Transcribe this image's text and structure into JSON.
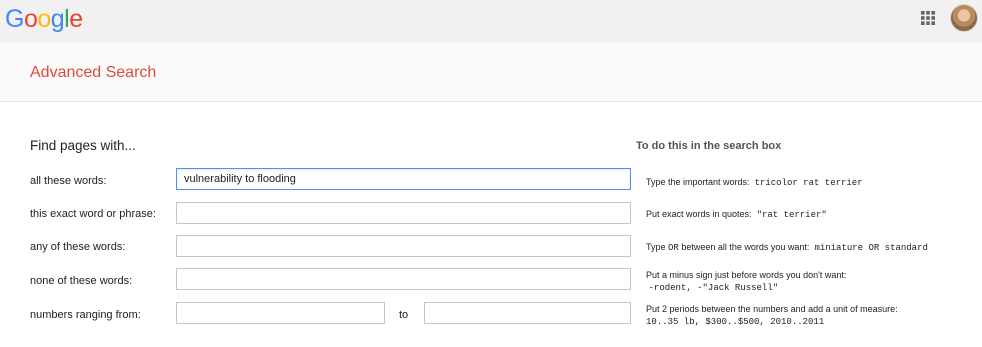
{
  "header": {
    "logo_letters": [
      {
        "ch": "G",
        "color": "#4285f4"
      },
      {
        "ch": "o",
        "color": "#ea4335"
      },
      {
        "ch": "o",
        "color": "#fbbc05"
      },
      {
        "ch": "g",
        "color": "#4285f4"
      },
      {
        "ch": "l",
        "color": "#34a853"
      },
      {
        "ch": "e",
        "color": "#ea4335"
      }
    ],
    "apps_icon": "apps-grid-icon",
    "avatar_icon": "user-avatar"
  },
  "page": {
    "title": "Advanced Search",
    "title_color": "#dd4b39"
  },
  "form": {
    "section_title": "Find pages with...",
    "hint_title": "To do this in the search box",
    "rows": [
      {
        "label": "all these words:",
        "value": "vulnerability to flooding",
        "hint_text": "Type the important words:",
        "hint_code": "tricolor rat terrier"
      },
      {
        "label": "this exact word or phrase:",
        "value": "",
        "hint_text": "Put exact words in quotes:",
        "hint_code": "\"rat terrier\""
      },
      {
        "label": "any of these words:",
        "value": "",
        "hint_text": "Type",
        "hint_code_or": "OR",
        "hint_text2": "between all the words you want:",
        "hint_code": "miniature OR standard"
      },
      {
        "label": "none of these words:",
        "value": "",
        "hint_text": "Put a minus sign just before words you don't want:",
        "hint_code": "-rodent, -\"Jack Russell\""
      },
      {
        "label": "numbers ranging from:",
        "value_from": "",
        "to_label": "to",
        "value_to": "",
        "hint_text": "Put 2 periods between the numbers and add a unit of measure:",
        "hint_code": "10..35 lb, $300..$500, 2010..2011"
      }
    ]
  }
}
